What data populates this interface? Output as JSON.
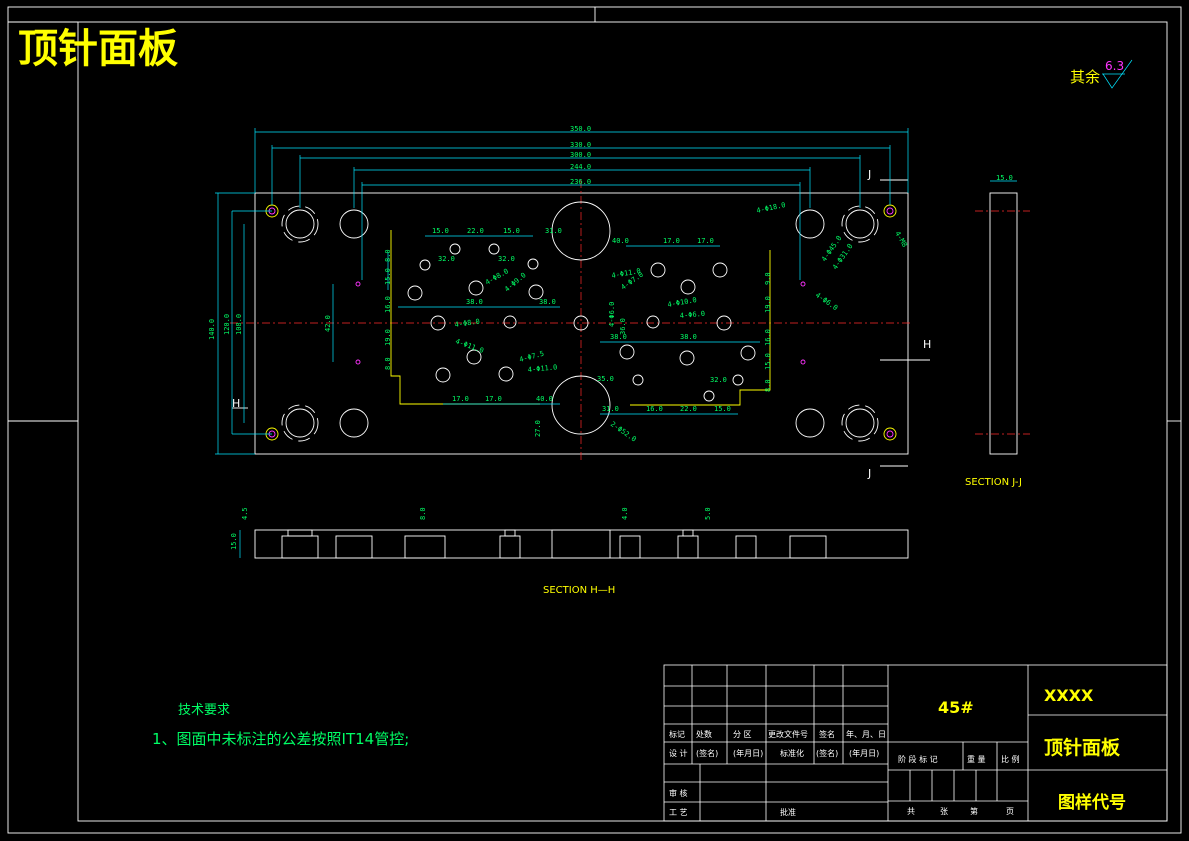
{
  "title": "顶针面板",
  "surface_finish": {
    "label": "其余",
    "value": "6.3"
  },
  "sections": {
    "jj_label": "SECTION J-J",
    "hh_label": "SECTION H—H",
    "cut_j": "J",
    "cut_h": "H"
  },
  "dims": {
    "overall": [
      "350.0",
      "330.0",
      "300.0",
      "244.0",
      "236.0"
    ],
    "left_vertical": [
      "140.0",
      "120.0",
      "108.0",
      "42.0"
    ],
    "section_jj_width": "15.0",
    "section_hh": [
      "4.5",
      "15.0",
      "8.0",
      "4.0",
      "5.0"
    ],
    "top_row": [
      "15.0",
      "22.0",
      "15.0",
      "31.0",
      "40.0",
      "17.0",
      "17.0"
    ],
    "inner_left": [
      "8.0",
      "32.0",
      "15.0",
      "32.0",
      "16.0",
      "19.0",
      "8.0",
      "38.0",
      "38.0"
    ],
    "inner_right": [
      "9.0",
      "19.0",
      "16.0",
      "15.0",
      "38.0",
      "32.0",
      "8.0",
      "38.0"
    ],
    "bottom_row": [
      "17.0",
      "17.0",
      "40.0",
      "31.0",
      "16.0",
      "22.0",
      "15.0",
      "27.0",
      "35.0",
      "36.0"
    ],
    "callouts": [
      "4-Φ18.0",
      "4-Φ45.0",
      "4-Φ31.0",
      "4-M8",
      "4-Φ6.0",
      "4-Φ8.0",
      "4-Φ10.0",
      "4-Φ6.0",
      "4-Φ11.0",
      "4-Φ7.0",
      "4-Φ8.0",
      "4-Φ9.0",
      "4-Φ11.0",
      "4-Φ7.5",
      "4-Φ11.0",
      "2-Φ52.0",
      "4-Φ6.0"
    ]
  },
  "tech_req": {
    "heading": "技术要求",
    "item": "1、图面中未标注的公差按照IT14管控;"
  },
  "title_block": {
    "material": "45#",
    "company": "XXXX",
    "part_name": "顶针面板",
    "drawing_no": "图样代号",
    "row_header": [
      "标记",
      "处数",
      "分 区",
      "更改文件号",
      "签名",
      "年、月、日"
    ],
    "row_design": [
      "设 计",
      "(签名)",
      "(年月日)",
      "标准化",
      "(签名)",
      "(年月日)"
    ],
    "row_review": "审 核",
    "row_process": "工 艺",
    "approve": "批准",
    "stage_labels": [
      "阶 段 标 记",
      "重 量",
      "比 例"
    ],
    "sheet_labels": [
      "共",
      "张",
      "第",
      "页"
    ]
  }
}
